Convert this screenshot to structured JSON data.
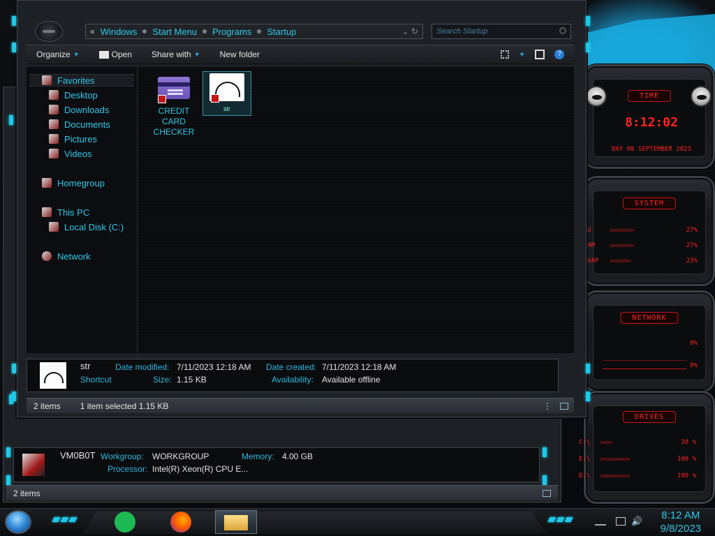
{
  "explorer": {
    "breadcrumb_prefix": "«",
    "breadcrumb": [
      "Windows",
      "Start Menu",
      "Programs",
      "Startup"
    ],
    "search_placeholder": "Search Startup",
    "toolbar": {
      "organize": "Organize",
      "open": "Open",
      "share_with": "Share with",
      "new_folder": "New folder"
    },
    "nav": {
      "favorites": "Favorites",
      "desktop": "Desktop",
      "downloads": "Downloads",
      "documents": "Documents",
      "pictures": "Pictures",
      "videos": "Videos",
      "homegroup": "Homegroup",
      "this_pc": "This PC",
      "local_disk": "Local Disk (C:)",
      "network": "Network"
    },
    "files": [
      {
        "label": "CREDIT CARD CHECKER",
        "line1": "CREDIT",
        "line2": "CARD",
        "line3": "CHECKER"
      },
      {
        "label": "str",
        "selected": true
      }
    ],
    "details": {
      "name": "str",
      "type": "Shortcut",
      "date_modified_label": "Date modified:",
      "date_modified": "7/11/2023 12:18 AM",
      "size_label": "Size:",
      "size": "1.15 KB",
      "date_created_label": "Date created:",
      "date_created": "7/11/2023 12:18 AM",
      "availability_label": "Availability:",
      "availability": "Available offline"
    },
    "status": {
      "items": "2 items",
      "selected": "1 item selected  1.15 KB"
    }
  },
  "back_window": {
    "computer_name": "VM0B0T",
    "workgroup_label": "Workgroup:",
    "workgroup": "WORKGROUP",
    "memory_label": "Memory:",
    "memory": "4.00 GB",
    "processor_label": "Processor:",
    "processor": "Intel(R) Xeon(R) CPU E...",
    "items": "2 items"
  },
  "gadgets": {
    "time_title": "TIME",
    "time": "8:12:02",
    "date": "DAY 08 SEPTEMBER 2023",
    "system_title": "SYSTEM",
    "cpu_label": "U",
    "cpu": "27%",
    "ram_label": "AM",
    "ram": "27%",
    "swap_label": "VAP",
    "swap": "23%",
    "network_title": "NETWORK",
    "net_up": "0%",
    "net_down": "0%",
    "drives_title": "DRIVES",
    "drive_c_label": "C:\\",
    "drive_c": "38 %",
    "drive_e_label": "E:\\",
    "drive_e": "100 %",
    "drive_d_label": "D:\\",
    "drive_d": "100 %"
  },
  "taskbar": {
    "time": "8:12 AM",
    "date": "9/8/2023"
  },
  "colors": {
    "accent_cyan": "#30c8e8",
    "gadget_red": "#ff2424",
    "window_bg": "#1d2024"
  }
}
